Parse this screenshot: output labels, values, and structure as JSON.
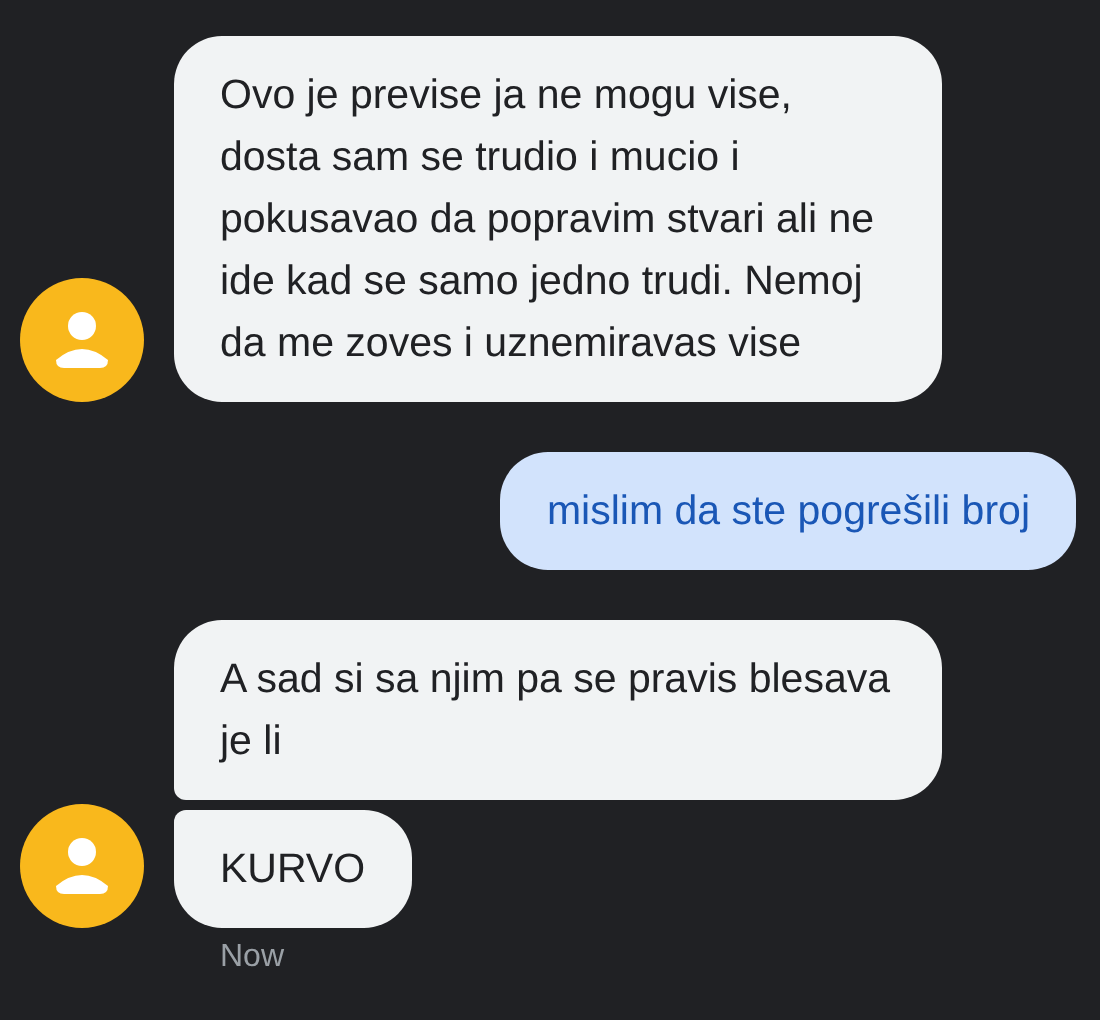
{
  "conversation": [
    {
      "kind": "incoming",
      "messages": [
        "Ovo je previse ja ne mogu vise, dosta sam se trudio i mucio i pokusavao da popravim stvari ali ne ide kad se samo jedno trudi. Nemoj da me zoves i uznemiravas vise"
      ]
    },
    {
      "kind": "outgoing",
      "messages": [
        "mislim da ste pogrešili broj"
      ]
    },
    {
      "kind": "incoming",
      "messages": [
        "A sad si sa njim pa se pravis blesava je li",
        "KURVO"
      ],
      "timestamp": "Now"
    }
  ]
}
